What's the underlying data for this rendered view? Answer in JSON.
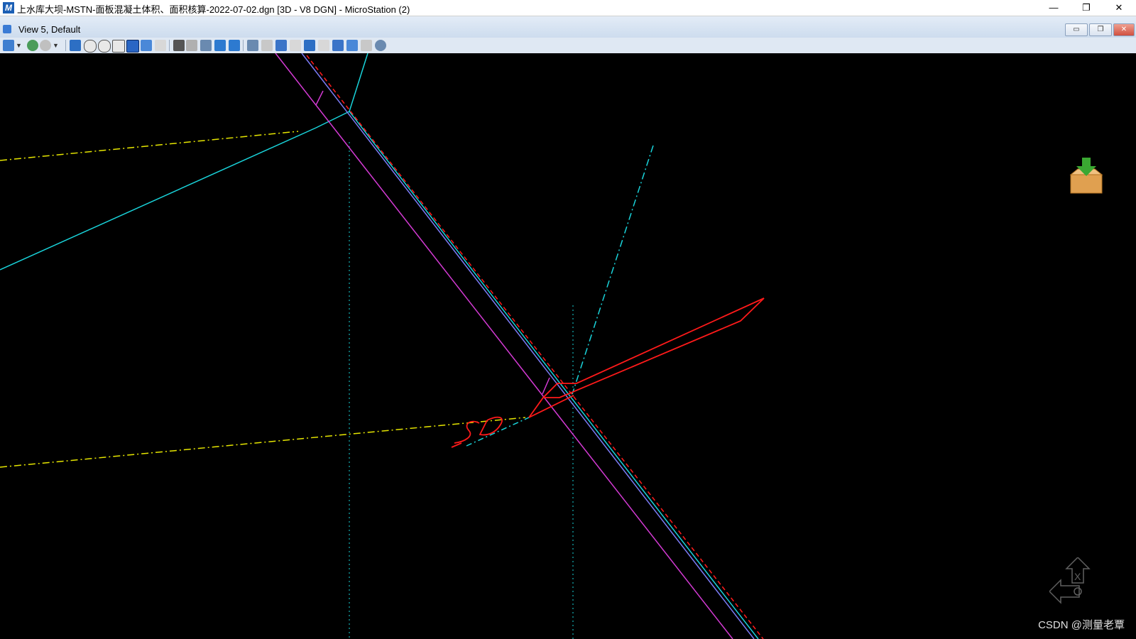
{
  "window": {
    "title": "上水库大坝-MSTN-面板混凝土体积、面积核算-2022-07-02.dgn [3D - V8 DGN] - MicroStation (2)",
    "minimize": "—",
    "restore": "❐",
    "close": "✕"
  },
  "view": {
    "title": "View 5, Default",
    "btn_min": "▭",
    "btn_restore": "❐",
    "btn_close": "✕"
  },
  "canvas": {
    "annotation": "SD",
    "axis_x_label": "X"
  },
  "colors": {
    "background": "#000000",
    "cyan": "#19d3da",
    "magenta": "#d43ad4",
    "blue": "#7c7cf7",
    "red": "#ff1a1a",
    "yellow": "#e6e600"
  },
  "watermark": "CSDN @测量老覃"
}
